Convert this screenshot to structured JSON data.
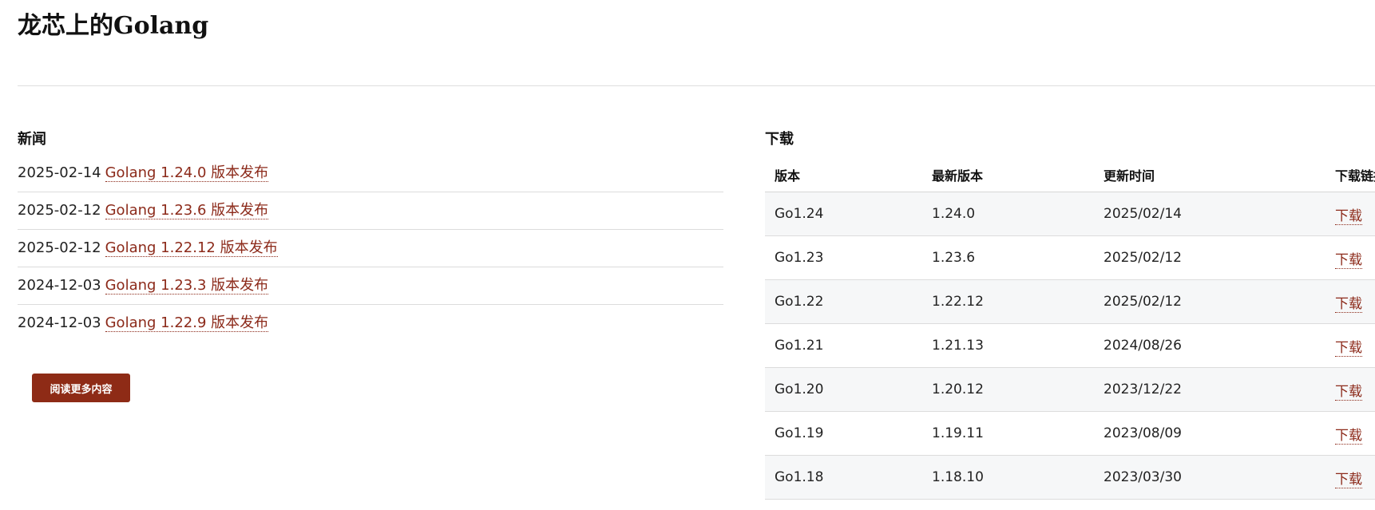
{
  "header": {
    "title": "龙芯上的Golang"
  },
  "news": {
    "heading": "新闻",
    "items": [
      {
        "date": "2025-02-14",
        "title": "Golang 1.24.0 版本发布"
      },
      {
        "date": "2025-02-12",
        "title": "Golang 1.23.6 版本发布"
      },
      {
        "date": "2025-02-12",
        "title": "Golang 1.22.12 版本发布"
      },
      {
        "date": "2024-12-03",
        "title": "Golang 1.23.3 版本发布"
      },
      {
        "date": "2024-12-03",
        "title": "Golang 1.22.9 版本发布"
      }
    ],
    "read_more_label": "阅读更多内容"
  },
  "downloads": {
    "heading": "下载",
    "columns": [
      "版本",
      "最新版本",
      "更新时间",
      "下载链接"
    ],
    "rows": [
      {
        "version": "Go1.24",
        "latest": "1.24.0",
        "updated": "2025/02/14",
        "link_label": "下载"
      },
      {
        "version": "Go1.23",
        "latest": "1.23.6",
        "updated": "2025/02/12",
        "link_label": "下载"
      },
      {
        "version": "Go1.22",
        "latest": "1.22.12",
        "updated": "2025/02/12",
        "link_label": "下载"
      },
      {
        "version": "Go1.21",
        "latest": "1.21.13",
        "updated": "2024/08/26",
        "link_label": "下载"
      },
      {
        "version": "Go1.20",
        "latest": "1.20.12",
        "updated": "2023/12/22",
        "link_label": "下载"
      },
      {
        "version": "Go1.19",
        "latest": "1.19.11",
        "updated": "2023/08/09",
        "link_label": "下载"
      },
      {
        "version": "Go1.18",
        "latest": "1.18.10",
        "updated": "2023/03/30",
        "link_label": "下载"
      }
    ]
  },
  "colors": {
    "accent": "#8e2b16",
    "link": "#8c2a1a",
    "divider": "#dcdcdc",
    "stripe": "#f6f7f8"
  }
}
